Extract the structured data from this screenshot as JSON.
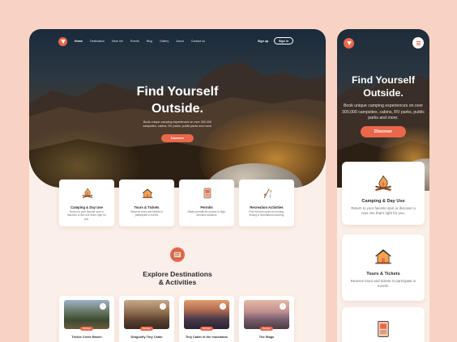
{
  "brand": {
    "accent": "#e9674b",
    "background": "#f8d3c3",
    "logo_icon": "tent-logo-icon"
  },
  "desktop": {
    "nav": {
      "items": [
        "Home",
        "Destination",
        "Near me",
        "Events",
        "Blog",
        "Gallery",
        "About",
        "Contact us"
      ],
      "signup": "Sign up",
      "signin": "Sign in"
    },
    "hero": {
      "title": "Find Yourself Outside.",
      "subtitle": "Book unique camping experiences on over 300,000 campsites, cabins, RV parks, public parks and more.",
      "cta": "Discover"
    },
    "features": [
      {
        "icon": "campfire-icon",
        "title": "Camping & Day Use",
        "desc": "Return to your favorite spot or discover a new one that's right for you."
      },
      {
        "icon": "cabin-icon",
        "title": "Tours & Tickets",
        "desc": "Reserve tours and tickets to participate in events"
      },
      {
        "icon": "permit-icon",
        "title": "Permits",
        "desc": "Obtain permits for access to high-demand locations"
      },
      {
        "icon": "fishing-icon",
        "title": "Recreation Activities",
        "desc": "Find the best spots for hunting, fishing & recreational shooting"
      }
    ],
    "explore": {
      "icon": "explore-ticket-icon",
      "title_line1": "Explore Destinations",
      "title_line2": "& Activities"
    },
    "destinations": [
      {
        "name": "Trickle Creek Ranch",
        "tag": "Bethage"
      },
      {
        "name": "Dragonfly Tiny Cabin",
        "tag": "Bethage"
      },
      {
        "name": "Tiny Cabin in the mountains",
        "tag": "Bethage"
      },
      {
        "name": "The Stage",
        "tag": "Bethage"
      }
    ]
  },
  "mobile": {
    "hero": {
      "title": "Find Yourself Outside.",
      "subtitle": "Book unique camping experiences on over 300,000 campsites, cabins, RV parks, public parks and more.",
      "cta": "Discover"
    },
    "features": [
      {
        "icon": "campfire-icon",
        "title": "Camping & Day Use",
        "desc": "Return to your favorite spot or discover a new one that's right for you."
      },
      {
        "icon": "cabin-icon",
        "title": "Tours & Tickets",
        "desc": "Reserve tours and tickets to participate in events."
      },
      {
        "icon": "permit-icon"
      }
    ]
  }
}
